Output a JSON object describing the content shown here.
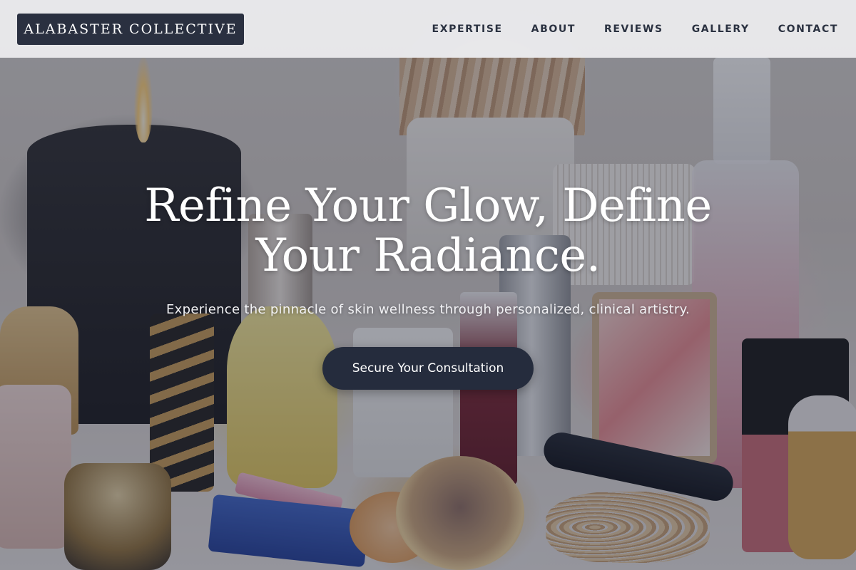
{
  "brand": {
    "name": "ALABASTER COLLECTIVE"
  },
  "nav": {
    "items": [
      {
        "label": "EXPERTISE"
      },
      {
        "label": "ABOUT"
      },
      {
        "label": "REVIEWS"
      },
      {
        "label": "GALLERY"
      },
      {
        "label": "CONTACT"
      }
    ]
  },
  "hero": {
    "title": "Refine Your Glow, Define Your Radiance.",
    "subtitle": "Experience the pinnacle of skin wellness through personalized, clinical artistry.",
    "cta_label": "Secure Your Consultation"
  },
  "colors": {
    "brand_bg": "#2a3040",
    "nav_text": "#2b3241",
    "cta_bg": "#252c3d",
    "overlay": "#23283a"
  }
}
